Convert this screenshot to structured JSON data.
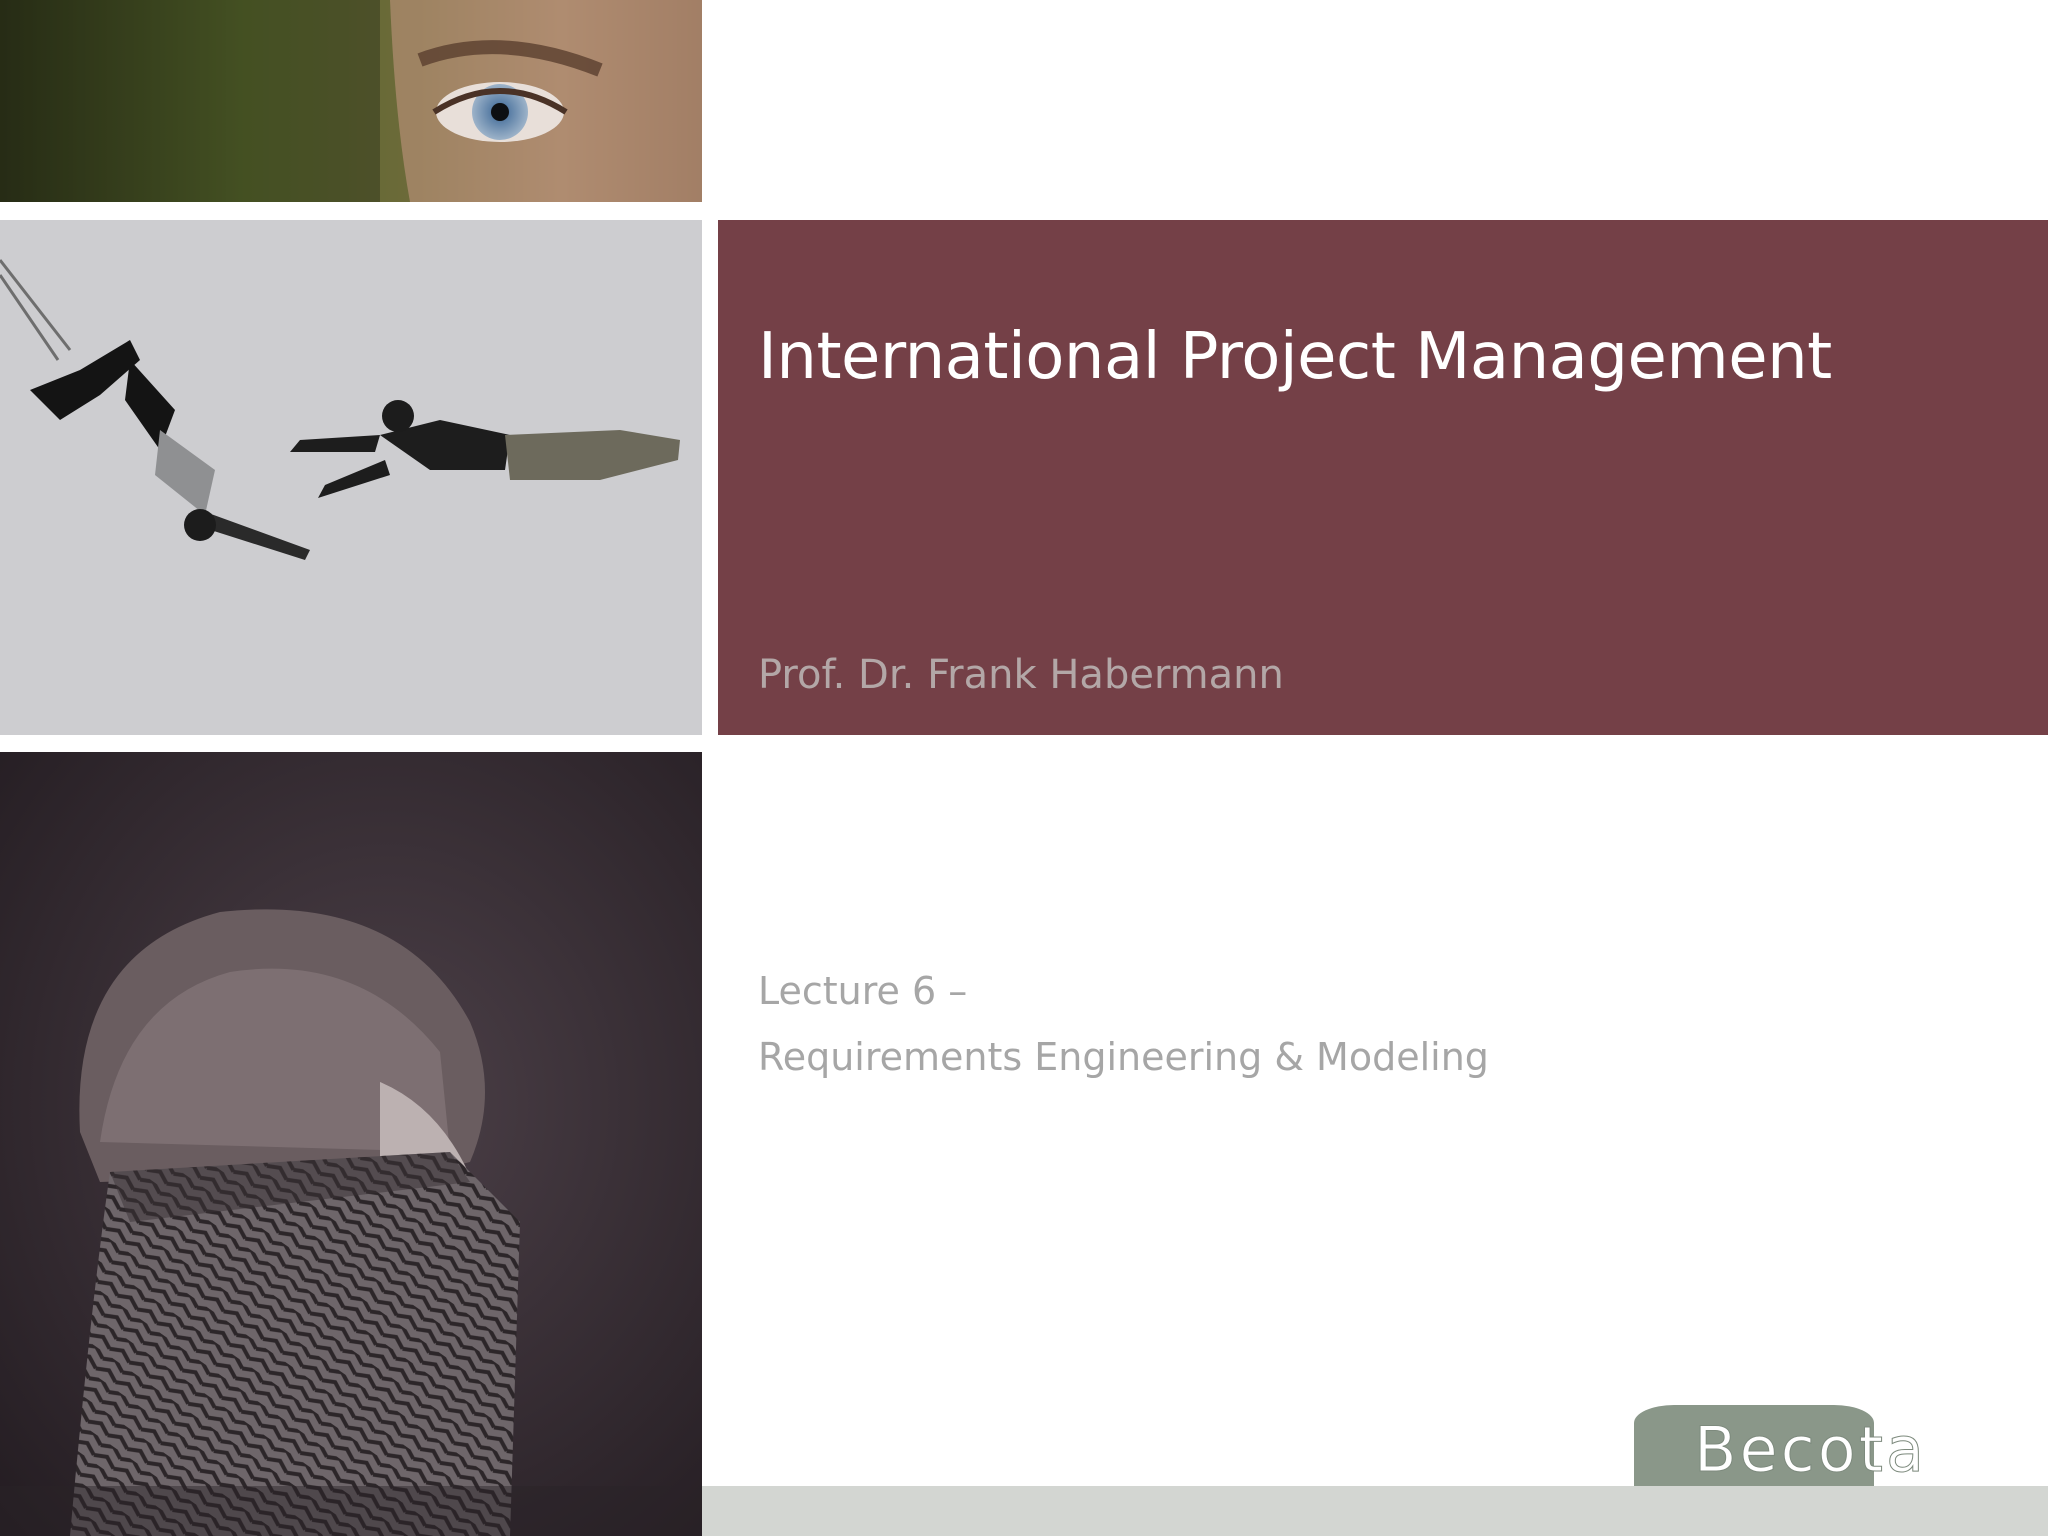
{
  "slide": {
    "title": "International Project Management",
    "presenter": "Prof. Dr. Frank Habermann",
    "lecture_number": "Lecture 6 –",
    "lecture_topic": "Requirements Engineering & Modeling"
  },
  "logo": {
    "text": "Becota"
  },
  "colors": {
    "title_band": "#744047",
    "footer_bar": "#d3d6d2",
    "logo_green": "#8a9789"
  }
}
